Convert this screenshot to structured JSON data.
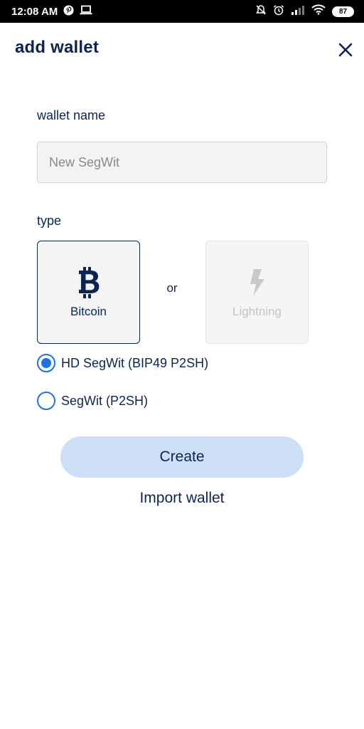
{
  "status_bar": {
    "time": "12:08 AM",
    "battery": "87",
    "icons": [
      "pinterest-icon",
      "laptop-icon",
      "mute-icon",
      "alarm-icon",
      "signal-icon",
      "wifi-icon",
      "battery-icon"
    ]
  },
  "header": {
    "title": "add wallet",
    "close_icon": "close-icon"
  },
  "form": {
    "name_label": "wallet name",
    "name_placeholder": "New SegWit",
    "name_value": "",
    "type_label": "type",
    "or_text": "or",
    "types": [
      {
        "label": "Bitcoin",
        "icon": "bitcoin-icon",
        "selected": true,
        "enabled": true
      },
      {
        "label": "Lightning",
        "icon": "lightning-icon",
        "selected": false,
        "enabled": false
      }
    ],
    "address_options": [
      {
        "label": "HD SegWit (BIP49 P2SH)",
        "checked": true
      },
      {
        "label": "SegWit (P2SH)",
        "checked": false
      }
    ]
  },
  "actions": {
    "create_label": "Create",
    "import_label": "Import wallet"
  },
  "colors": {
    "primary_text": "#0c2550",
    "radio_accent": "#1a73e8",
    "create_button_bg": "#ccdff7"
  }
}
